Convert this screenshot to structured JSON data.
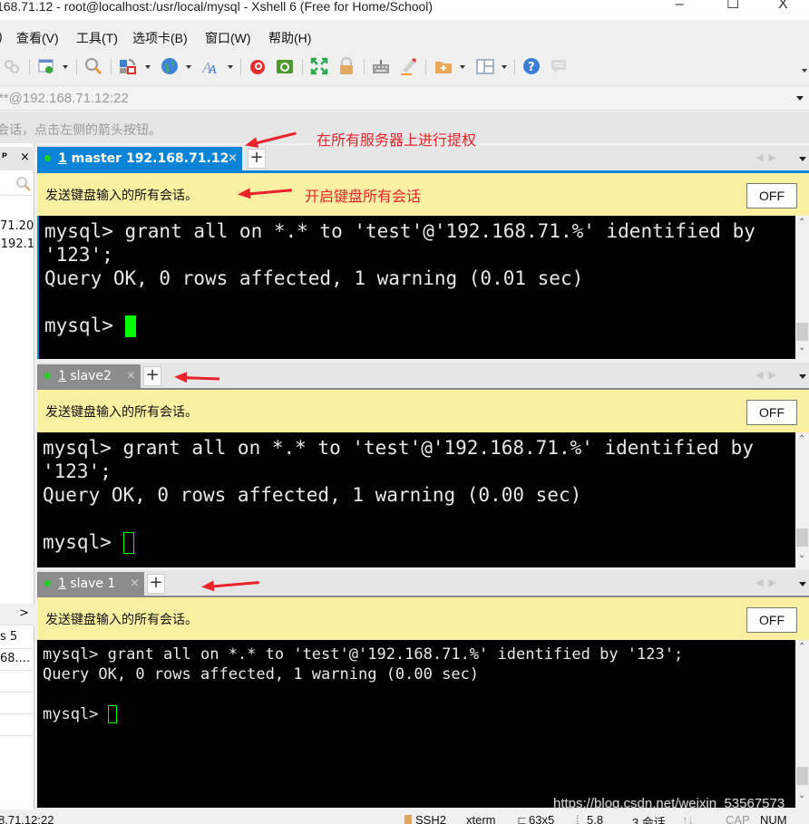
{
  "window": {
    "title": "168.71.12 - root@localhost:/usr/local/mysql - Xshell 6 (Free for Home/School)",
    "minimize": "–",
    "maximize": "☐",
    "close": "X"
  },
  "menu": {
    "items": [
      ")",
      "查看(V)",
      "工具(T)",
      "选项卡(B)",
      "窗口(W)",
      "帮助(H)"
    ]
  },
  "toolbar": {
    "icons": [
      "link-icon",
      "session-settings-icon",
      "find-icon",
      "transfer-icon",
      "globe-icon",
      "font-icon",
      "xftp-red-icon",
      "xftp-green-icon",
      "fullscreen-icon",
      "lock-icon",
      "keyboard-icon",
      "highlight-icon",
      "new-folder-icon",
      "layout-icon",
      "help-icon",
      "chat-icon"
    ]
  },
  "address_bar": {
    "value": "**@192.168.71.12:22"
  },
  "hint_bar": {
    "text": "会话，点击左侧的箭头按钮。"
  },
  "annotations": {
    "note1": "在所有服务器上进行提权",
    "note2": "开启键盘所有会话"
  },
  "sidebar": {
    "pin": "ᵖ",
    "close": "×",
    "rows_top": [
      "71.20",
      "192.1"
    ],
    "more": ">",
    "rows_bottom": [
      "s 5",
      "68...."
    ]
  },
  "panes": [
    {
      "tab_number": "1",
      "tab_label": " master  192.168.71.12",
      "active": true,
      "send_text": "发送键盘输入的所有会话。",
      "off_label": "OFF",
      "lines": [
        "mysql> grant all on *.* to 'test'@'192.168.71.%' identified by",
        "'123';",
        "Query OK, 0 rows affected, 1 warning (0.01 sec)",
        "",
        "mysql> "
      ]
    },
    {
      "tab_number": "1",
      "tab_label": " slave2",
      "active": false,
      "send_text": "发送键盘输入的所有会话。",
      "off_label": "OFF",
      "lines": [
        "mysql> grant all on *.* to 'test'@'192.168.71.%' identified by",
        "'123';",
        "Query OK, 0 rows affected, 1 warning (0.00 sec)",
        "",
        "mysql> "
      ]
    },
    {
      "tab_number": "1",
      "tab_label": " slave 1",
      "active": false,
      "send_text": "发送键盘输入的所有会话。",
      "off_label": "OFF",
      "lines": [
        "mysql> grant all on *.* to 'test'@'192.168.71.%' identified by '123';",
        "Query OK, 0 rows affected, 1 warning (0.00 sec)",
        "",
        "mysql> "
      ]
    }
  ],
  "status_bar": {
    "host": "8.71.12:22",
    "protocol": "SSH2",
    "term": "xterm",
    "size": "63x5",
    "cursor": "5,8",
    "sessions": "3 会话",
    "cap": "CAP",
    "num": "NUM"
  },
  "watermark": "https://blog.csdn.net/weixin_53567573",
  "colors": {
    "active_tab": "#0a84d6",
    "inactive_tab": "#8c8c8c",
    "send_bar": "#fbf0a2",
    "annotation": "#e8232b",
    "cursor": "#00ff00"
  }
}
